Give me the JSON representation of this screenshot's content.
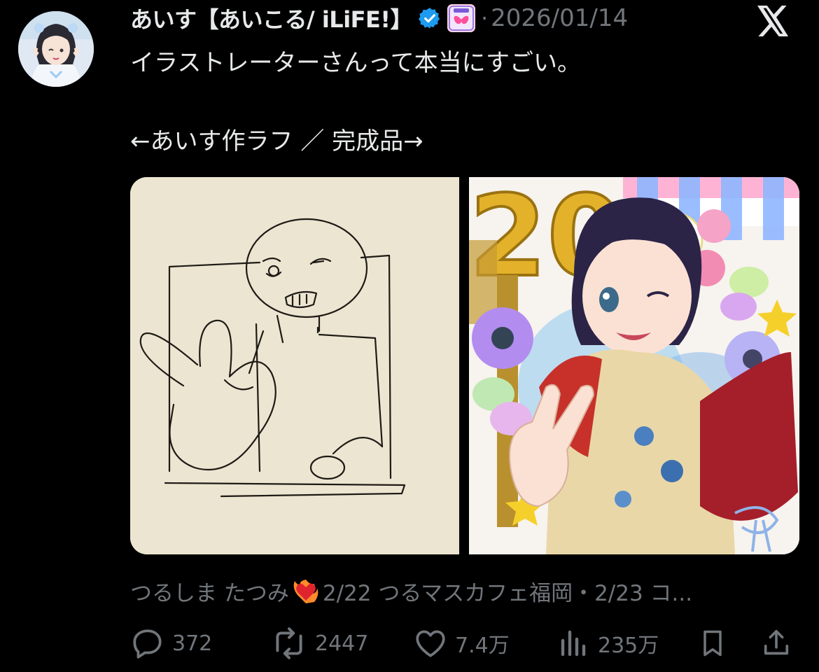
{
  "tweet": {
    "author_name": "あいす【あいこる/ iLiFE!】",
    "separator": "·",
    "date": "2026/01/14",
    "text_lines": [
      "イラストレーターさんって本当にすごい。",
      "",
      "←あいす作ラフ ／ 完成品→"
    ],
    "quoted_preview_prefix": "つるしま たつみ",
    "quoted_preview_suffix": "2/22 つるマスカフェ福岡・2/23 コ...",
    "image_text": {
      "balloon_number": "20"
    }
  },
  "actions": {
    "reply_count": "372",
    "repost_count": "2447",
    "like_count": "7.4万",
    "view_count": "235万"
  },
  "icons": {
    "avatar": "avatar-photo",
    "verified": "verified-badge-icon",
    "group_badge": "group-affiliation-badge",
    "x_logo": "x-logo-icon",
    "reply": "reply-icon",
    "repost": "repost-icon",
    "like": "heart-icon",
    "views": "views-chart-icon",
    "bookmark": "bookmark-icon",
    "share": "share-icon",
    "emoji": "heart-on-fire-emoji"
  },
  "colors": {
    "background": "#000000",
    "text": "#e7e9ea",
    "secondary_text": "#71767b",
    "verified_blue": "#1d9bf0"
  }
}
